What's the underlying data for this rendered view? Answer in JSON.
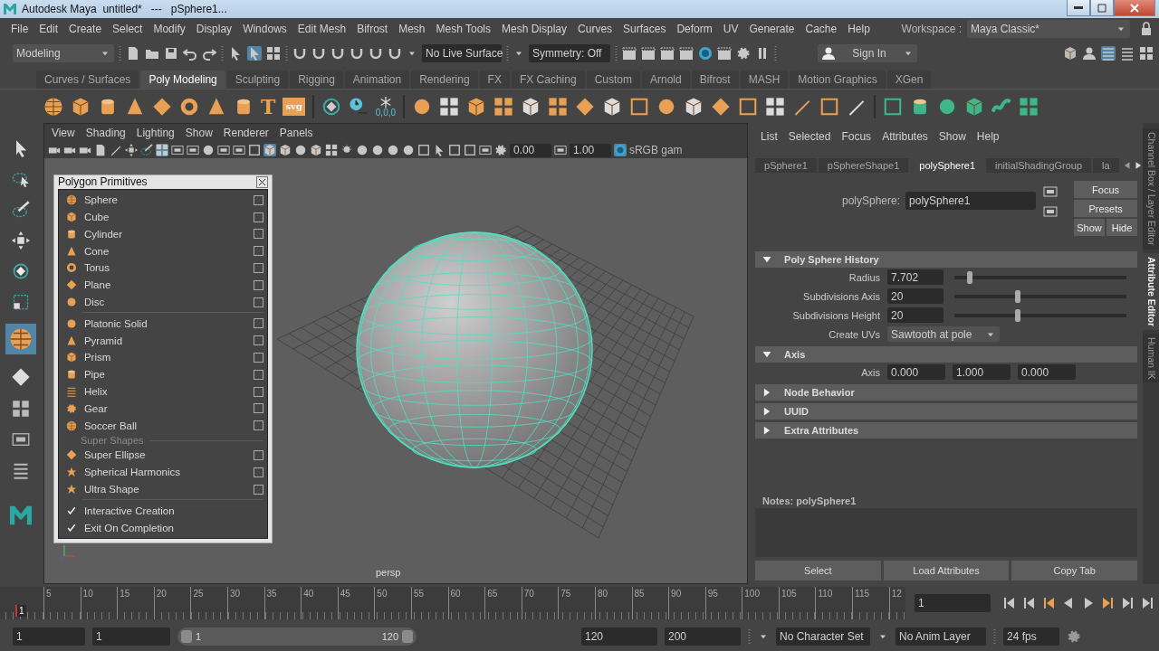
{
  "title_bar": {
    "title": "Autodesk Maya  untitled*   ---   pSphere1..."
  },
  "menu_bar": {
    "items": [
      "File",
      "Edit",
      "Create",
      "Select",
      "Modify",
      "Display",
      "Windows",
      "Edit Mesh",
      "Bifrost",
      "Mesh",
      "Mesh Tools",
      "Mesh Display",
      "Curves",
      "Surfaces",
      "Deform",
      "UV",
      "Generate",
      "Cache",
      "Help"
    ],
    "workspace_label": "Workspace :",
    "workspace": "Maya Classic*"
  },
  "status_line": {
    "mode": "Modeling",
    "live_surface": "No Live Surface",
    "symmetry": "Symmetry: Off",
    "sign_in": "Sign In"
  },
  "shelf": {
    "tabs": [
      {
        "label": "Curves / Surfaces",
        "selected": false
      },
      {
        "label": "Poly Modeling",
        "selected": true
      },
      {
        "label": "Sculpting",
        "selected": false
      },
      {
        "label": "Rigging",
        "selected": false
      },
      {
        "label": "Animation",
        "selected": false
      },
      {
        "label": "Rendering",
        "selected": false
      },
      {
        "label": "FX",
        "selected": false
      },
      {
        "label": "FX Caching",
        "selected": false
      },
      {
        "label": "Custom",
        "selected": false
      },
      {
        "label": "Arnold",
        "selected": false
      },
      {
        "label": "Bifrost",
        "selected": false
      },
      {
        "label": "MASH",
        "selected": false
      },
      {
        "label": "Motion Graphics",
        "selected": false
      },
      {
        "label": "XGen",
        "selected": false
      }
    ],
    "type_tool": "T",
    "svg_tool": "svg",
    "freeze_label": "0,0,0"
  },
  "viewport": {
    "menus": [
      "View",
      "Shading",
      "Lighting",
      "Show",
      "Renderer",
      "Panels"
    ],
    "exposure": "0.00",
    "gamma": "1.00",
    "color_space": "sRGB gam",
    "camera": "persp"
  },
  "primitives_window": {
    "title": "Polygon Primitives",
    "groups": [
      {
        "items": [
          {
            "kind": "item",
            "label": "Sphere",
            "checked": false
          },
          {
            "kind": "item",
            "label": "Cube",
            "checked": false
          },
          {
            "kind": "item",
            "label": "Cylinder",
            "checked": false
          },
          {
            "kind": "item",
            "label": "Cone",
            "checked": false
          },
          {
            "kind": "item",
            "label": "Torus",
            "checked": false
          },
          {
            "kind": "item",
            "label": "Plane",
            "checked": false
          },
          {
            "kind": "item",
            "label": "Disc",
            "checked": false
          }
        ]
      },
      {
        "items": [
          {
            "kind": "item",
            "label": "Platonic Solid",
            "checked": false
          },
          {
            "kind": "item",
            "label": "Pyramid",
            "checked": false
          },
          {
            "kind": "item",
            "label": "Prism",
            "checked": false
          },
          {
            "kind": "item",
            "label": "Pipe",
            "checked": false
          },
          {
            "kind": "item",
            "label": "Helix",
            "checked": false
          },
          {
            "kind": "item",
            "label": "Gear",
            "checked": false
          },
          {
            "kind": "item",
            "label": "Soccer Ball",
            "checked": false
          }
        ]
      },
      {
        "heading": "Super Shapes",
        "items": [
          {
            "kind": "item",
            "label": "Super Ellipse",
            "checked": false
          },
          {
            "kind": "item",
            "label": "Spherical Harmonics",
            "checked": false
          },
          {
            "kind": "item",
            "label": "Ultra Shape",
            "checked": false
          }
        ]
      },
      {
        "items": [
          {
            "kind": "option",
            "label": "Interactive Creation",
            "checked": true
          },
          {
            "kind": "option",
            "label": "Exit On Completion",
            "checked": true
          }
        ]
      }
    ]
  },
  "attribute_editor": {
    "menus": [
      "List",
      "Selected",
      "Focus",
      "Attributes",
      "Show",
      "Help"
    ],
    "tabs": [
      {
        "label": "pSphere1",
        "selected": false
      },
      {
        "label": "pSphereShape1",
        "selected": false
      },
      {
        "label": "polySphere1",
        "selected": true
      },
      {
        "label": "initialShadingGroup",
        "selected": false
      },
      {
        "label": "la",
        "selected": false
      }
    ],
    "node_label": "polySphere:",
    "node_name": "polySphere1",
    "buttons": [
      "Focus",
      "Presets",
      "Show",
      "Hide"
    ],
    "sections": [
      {
        "title": "Poly Sphere History",
        "expanded": true,
        "rows": [
          {
            "kind": "slider",
            "label": "Radius",
            "value": "7.702",
            "level": 0.09
          },
          {
            "kind": "slider",
            "label": "Subdivisions Axis",
            "value": "20",
            "level": 0.37
          },
          {
            "kind": "slider",
            "label": "Subdivisions Height",
            "value": "20",
            "level": 0.37
          },
          {
            "kind": "dropdown",
            "label": "Create UVs",
            "value": "Sawtooth at pole"
          }
        ]
      },
      {
        "title": "Axis",
        "expanded": true,
        "rows": [
          {
            "kind": "vector",
            "label": "Axis",
            "values": [
              "0.000",
              "1.000",
              "0.000"
            ]
          }
        ]
      },
      {
        "title": "Node Behavior",
        "expanded": false
      },
      {
        "title": "UUID",
        "expanded": false
      },
      {
        "title": "Extra Attributes",
        "expanded": false
      }
    ],
    "notes_label": "Notes:  polySphere1",
    "footer_buttons": [
      "Select",
      "Load Attributes",
      "Copy Tab"
    ],
    "side_tabs": [
      {
        "label": "Channel Box / Layer Editor",
        "selected": false
      },
      {
        "label": "Attribute Editor",
        "selected": true
      },
      {
        "label": "Human IK",
        "selected": false
      }
    ]
  },
  "timeline": {
    "ticks": [
      "5",
      "10",
      "15",
      "20",
      "25",
      "30",
      "35",
      "40",
      "45",
      "50",
      "55",
      "60",
      "65",
      "70",
      "75",
      "80",
      "85",
      "90",
      "95",
      "100",
      "105",
      "110",
      "115",
      "12"
    ],
    "current_marker": "1",
    "level": 0,
    "current_frame": "1"
  },
  "range": {
    "start": "1",
    "inner_start": "1",
    "slider_start": "1",
    "slider_end": "120",
    "level": 1,
    "inner_end": "120",
    "end": "200",
    "character_set": "No Character Set",
    "anim_layer": "No Anim Layer",
    "fps": "24 fps"
  }
}
